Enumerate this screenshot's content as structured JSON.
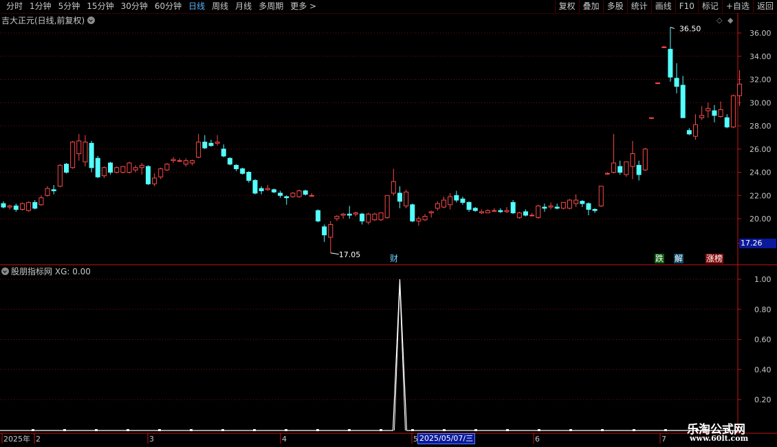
{
  "toolbar": {
    "periods": [
      "分时",
      "1分钟",
      "5分钟",
      "15分钟",
      "30分钟",
      "60分钟",
      "日线",
      "周线",
      "月线",
      "多周期",
      "更多 >"
    ],
    "active_period": "日线",
    "buttons": [
      "复权",
      "叠加",
      "多股",
      "统计",
      "画线",
      "F10",
      "标记",
      "+自选",
      "返回"
    ]
  },
  "main_panel": {
    "title": "吉大正元(日线,前复权)",
    "high_label": "36.50",
    "low_label": "17.05",
    "current_price": "17.26",
    "y_ticks": [
      "36.00",
      "34.00",
      "32.00",
      "30.00",
      "28.00",
      "26.00",
      "24.00",
      "22.00",
      "20.00"
    ],
    "flags": {
      "cai": "财",
      "die": "跌",
      "jie": "解",
      "zhangbang": "涨榜"
    }
  },
  "indicator_panel": {
    "title": "股朋指标网",
    "xg_label": "XG: 0.00",
    "y_ticks": [
      "1.00",
      "0.80",
      "0.60",
      "0.40",
      "0.20"
    ]
  },
  "x_axis": {
    "labels": [
      "2025年",
      "2",
      "3",
      "4",
      "5",
      "6",
      "7"
    ],
    "selected_date": "2025/05/07/三"
  },
  "watermark": {
    "title": "乐淘公式网",
    "url": "www.60lt.com"
  },
  "colors": {
    "up": "#ff4a4a",
    "down": "#54ffff",
    "grid": "#7a1010",
    "axis": "#c81414",
    "line": "#ffffff"
  },
  "chart_data": {
    "type": "candlestick",
    "symbol_title": "吉大正元(日线,前复权)",
    "y_range": [
      17.0,
      37.0
    ],
    "ohlc": [
      [
        21.3,
        21.5,
        20.9,
        21.0
      ],
      [
        21.0,
        21.2,
        20.8,
        21.1
      ],
      [
        21.1,
        21.3,
        20.6,
        20.8
      ],
      [
        20.8,
        21.4,
        20.7,
        21.3
      ],
      [
        20.7,
        21.5,
        20.6,
        21.4
      ],
      [
        21.4,
        21.6,
        20.8,
        20.9
      ],
      [
        21.2,
        22.0,
        21.1,
        21.8
      ],
      [
        22.0,
        22.8,
        21.9,
        22.6
      ],
      [
        22.5,
        22.9,
        22.1,
        22.4
      ],
      [
        22.8,
        24.7,
        22.7,
        24.6
      ],
      [
        24.7,
        24.8,
        23.9,
        24.0
      ],
      [
        24.4,
        26.7,
        24.3,
        26.6
      ],
      [
        25.6,
        27.3,
        25.0,
        26.7
      ],
      [
        24.9,
        27.2,
        24.5,
        26.6
      ],
      [
        26.5,
        26.7,
        24.0,
        24.4
      ],
      [
        25.2,
        25.4,
        23.5,
        23.6
      ],
      [
        23.7,
        24.5,
        23.5,
        24.4
      ],
      [
        24.8,
        24.9,
        23.8,
        24.0
      ],
      [
        24.0,
        24.5,
        23.9,
        24.4
      ],
      [
        24.0,
        24.5,
        23.9,
        24.5
      ],
      [
        24.0,
        24.9,
        23.9,
        24.8
      ],
      [
        24.2,
        24.6,
        24.0,
        24.4
      ],
      [
        24.4,
        24.8,
        23.8,
        24.6
      ],
      [
        24.5,
        24.6,
        22.9,
        23.0
      ],
      [
        23.0,
        23.9,
        22.8,
        23.5
      ],
      [
        23.6,
        24.4,
        23.4,
        24.3
      ],
      [
        24.2,
        24.8,
        24.1,
        24.7
      ],
      [
        25.0,
        25.3,
        24.8,
        25.1
      ],
      [
        25.0,
        25.2,
        24.9,
        25.0
      ],
      [
        24.7,
        25.2,
        24.5,
        25.0
      ],
      [
        24.8,
        25.1,
        24.6,
        25.0
      ],
      [
        25.3,
        27.3,
        25.2,
        26.6
      ],
      [
        26.6,
        27.2,
        26.0,
        26.1
      ],
      [
        26.5,
        26.8,
        26.2,
        26.3
      ],
      [
        26.5,
        27.2,
        26.3,
        26.6
      ],
      [
        26.0,
        26.4,
        25.3,
        25.4
      ],
      [
        25.2,
        25.3,
        24.6,
        24.7
      ],
      [
        24.6,
        24.7,
        24.1,
        24.3
      ],
      [
        24.3,
        24.4,
        23.8,
        23.9
      ],
      [
        24.0,
        24.1,
        23.1,
        23.3
      ],
      [
        23.3,
        23.4,
        22.1,
        22.2
      ],
      [
        22.6,
        22.8,
        22.1,
        22.4
      ],
      [
        22.5,
        22.9,
        22.4,
        22.6
      ],
      [
        22.5,
        22.6,
        22.2,
        22.3
      ],
      [
        22.2,
        22.4,
        21.8,
        22.0
      ],
      [
        21.9,
        22.0,
        21.2,
        21.8
      ],
      [
        21.9,
        22.3,
        21.8,
        22.2
      ],
      [
        21.9,
        22.5,
        21.8,
        22.4
      ],
      [
        22.4,
        22.5,
        22.0,
        22.1
      ],
      [
        22.0,
        22.2,
        21.9,
        22.0
      ],
      [
        20.7,
        20.8,
        19.7,
        19.8
      ],
      [
        19.3,
        19.5,
        18.0,
        18.6
      ],
      [
        18.4,
        19.8,
        17.05,
        19.5
      ],
      [
        20.0,
        20.3,
        19.8,
        20.2
      ],
      [
        20.3,
        20.5,
        20.0,
        20.4
      ],
      [
        20.4,
        21.1,
        20.0,
        20.3
      ],
      [
        20.4,
        20.6,
        20.2,
        20.5
      ],
      [
        20.4,
        20.5,
        19.5,
        19.8
      ],
      [
        19.7,
        20.5,
        19.5,
        20.4
      ],
      [
        19.9,
        20.5,
        19.8,
        20.4
      ],
      [
        19.9,
        20.5,
        19.8,
        20.5
      ],
      [
        20.1,
        22.0,
        20.0,
        22.0
      ],
      [
        22.2,
        24.3,
        22.0,
        23.2
      ],
      [
        22.2,
        22.8,
        20.9,
        21.5
      ],
      [
        21.1,
        22.5,
        20.9,
        22.3
      ],
      [
        21.2,
        21.3,
        19.7,
        19.8
      ],
      [
        19.8,
        20.2,
        19.4,
        20.0
      ],
      [
        19.9,
        20.4,
        19.8,
        20.2
      ],
      [
        20.5,
        20.7,
        20.1,
        20.6
      ],
      [
        20.9,
        21.5,
        20.7,
        21.3
      ],
      [
        21.0,
        21.9,
        20.9,
        21.6
      ],
      [
        21.2,
        22.2,
        20.8,
        21.9
      ],
      [
        22.0,
        22.4,
        21.4,
        21.6
      ],
      [
        21.7,
        21.9,
        21.2,
        21.4
      ],
      [
        21.4,
        21.5,
        20.6,
        20.8
      ],
      [
        20.9,
        21.0,
        20.6,
        20.7
      ],
      [
        20.5,
        20.8,
        20.4,
        20.6
      ],
      [
        20.5,
        20.8,
        20.5,
        20.7
      ],
      [
        20.7,
        20.9,
        20.6,
        20.7
      ],
      [
        20.7,
        20.9,
        20.5,
        20.6
      ],
      [
        20.6,
        21.0,
        20.5,
        20.7
      ],
      [
        21.4,
        21.6,
        20.4,
        20.5
      ],
      [
        20.1,
        20.6,
        20.0,
        20.5
      ],
      [
        20.6,
        20.8,
        20.2,
        20.3
      ],
      [
        20.3,
        20.5,
        20.2,
        20.3
      ],
      [
        20.1,
        21.2,
        20.0,
        21.1
      ],
      [
        21.0,
        21.3,
        20.6,
        20.9
      ],
      [
        21.0,
        21.4,
        20.8,
        21.1
      ],
      [
        21.0,
        21.3,
        20.8,
        20.9
      ],
      [
        20.9,
        21.3,
        20.8,
        21.4
      ],
      [
        20.9,
        21.7,
        20.8,
        21.6
      ],
      [
        21.3,
        22.1,
        21.0,
        21.6
      ],
      [
        21.5,
        21.6,
        21.0,
        21.3
      ],
      [
        21.3,
        21.4,
        20.3,
        20.8
      ],
      [
        20.8,
        20.9,
        20.5,
        20.7
      ],
      [
        21.1,
        22.8,
        21.0,
        22.8
      ],
      [
        23.9,
        24.0,
        23.8,
        23.9
      ],
      [
        24.0,
        27.3,
        23.9,
        24.8
      ],
      [
        24.5,
        25.0,
        23.8,
        24.0
      ],
      [
        23.8,
        24.9,
        23.6,
        24.9
      ],
      [
        24.5,
        26.7,
        23.4,
        25.6
      ],
      [
        24.6,
        25.0,
        23.3,
        23.8
      ],
      [
        24.2,
        26.1,
        24.1,
        26.0
      ],
      [
        28.7,
        28.7,
        28.6,
        28.7
      ],
      [
        31.7,
        31.7,
        31.6,
        31.7
      ],
      [
        34.8,
        34.9,
        34.7,
        34.8
      ],
      [
        34.6,
        36.5,
        31.8,
        32.2
      ],
      [
        32.1,
        33.4,
        30.8,
        31.4
      ],
      [
        31.5,
        32.3,
        28.7,
        28.7
      ],
      [
        27.6,
        27.8,
        27.2,
        27.3
      ],
      [
        27.1,
        29.0,
        26.8,
        28.1
      ],
      [
        28.7,
        29.7,
        28.5,
        28.9
      ],
      [
        29.3,
        30.0,
        28.7,
        29.5
      ],
      [
        29.3,
        29.8,
        28.3,
        28.9
      ],
      [
        28.8,
        30.1,
        28.7,
        29.4
      ],
      [
        28.7,
        29.0,
        27.8,
        27.9
      ],
      [
        27.9,
        30.7,
        27.8,
        30.6
      ],
      [
        30.6,
        32.8,
        29.7,
        31.6
      ]
    ],
    "indicator": {
      "name": "XG",
      "y_range": [
        0,
        1.0
      ],
      "spike_at_index": 63,
      "spike_value": 1.0
    }
  }
}
